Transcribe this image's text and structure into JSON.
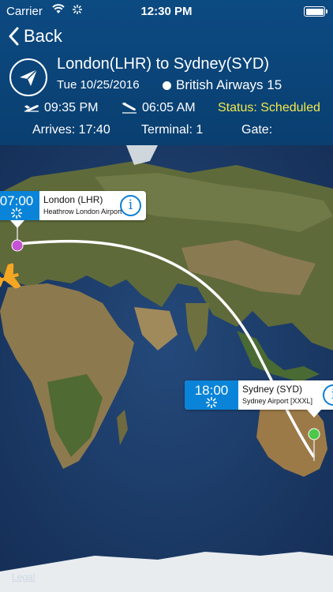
{
  "status_bar": {
    "carrier": "Carrier",
    "time": "12:30 PM"
  },
  "nav": {
    "back_label": "Back"
  },
  "flight": {
    "route": "London(LHR) to Sydney(SYD)",
    "date": "Tue 10/25/2016",
    "airline": "British Airways 15",
    "departure_time": "09:35 PM",
    "arrival_time": "06:05 AM",
    "status": "Status: Scheduled",
    "arrives": "Arrives: 17:40",
    "terminal": "Terminal: 1",
    "gate": "Gate:"
  },
  "map": {
    "origin": {
      "time": "07:00",
      "name": "London (LHR)",
      "airport": "Heathrow London Airport"
    },
    "destination": {
      "time": "18:00",
      "name": "Sydney (SYD)",
      "airport": "Sydney Airport [XXXL]"
    },
    "legal": "Legal"
  },
  "colors": {
    "header": "#0c4a82",
    "status_text": "#f2e84a",
    "callout_time_bg": "#0a84d8",
    "route_line": "#ffffff",
    "plane": "#f5a623",
    "origin_pin": "#c653d4",
    "destination_pin": "#4cc84a"
  }
}
